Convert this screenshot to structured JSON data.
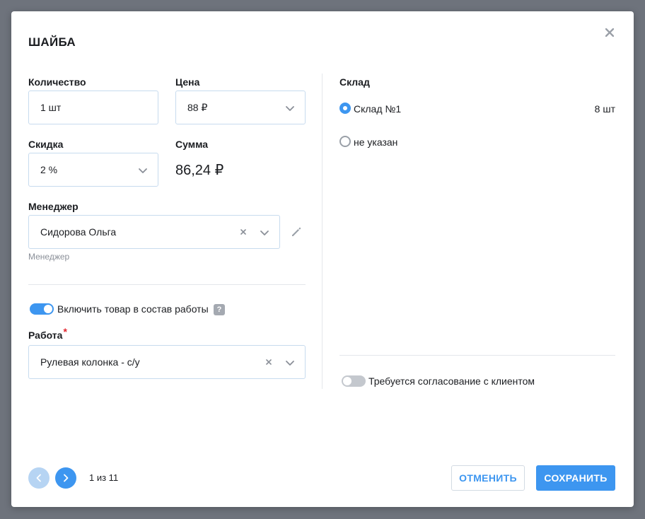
{
  "dialog": {
    "title": "ШАЙБА"
  },
  "fields": {
    "quantity_label": "Количество",
    "quantity_value": "1 шт",
    "price_label": "Цена",
    "price_value": "88 ₽",
    "discount_label": "Скидка",
    "discount_value": "2 %",
    "sum_label": "Сумма",
    "sum_value": "86,24 ₽",
    "manager_label": "Менеджер",
    "manager_value": "Сидорова Ольга",
    "manager_hint": "Менеджер",
    "include_in_work_label": "Включить товар в состав работы",
    "include_in_work_on": true,
    "work_label": "Работа",
    "work_required_mark": "*",
    "work_value": "Рулевая колонка - с/у"
  },
  "warehouse": {
    "label": "Склад",
    "options": [
      {
        "name": "Склад №1",
        "qty": "8 шт",
        "selected": true
      },
      {
        "name": "не указан",
        "qty": "",
        "selected": false
      }
    ],
    "client_approval_label": "Требуется согласование с клиентом",
    "client_approval_on": false
  },
  "pager": {
    "text": "1 из 11"
  },
  "actions": {
    "cancel_label": "ОТМЕНИТЬ",
    "save_label": "СОХРАНИТЬ"
  },
  "icons": {
    "close": "close-icon",
    "chevron": "chevron-down-icon",
    "clear": "clear-icon",
    "edit": "pencil-icon",
    "help": "help-icon",
    "prev": "chevron-left-icon",
    "next": "chevron-right-icon"
  },
  "colors": {
    "accent": "#3d96f0",
    "accent_light": "#b6d4f3",
    "required": "#e3262f",
    "border": "#c7dbee"
  }
}
